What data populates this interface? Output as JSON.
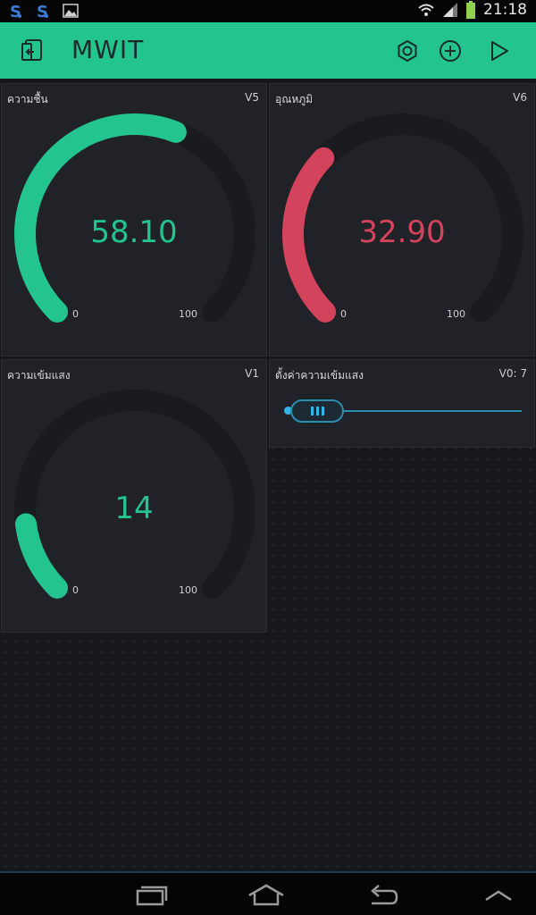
{
  "status_bar": {
    "time": "21:18",
    "left_icons": [
      "app-notification-icon",
      "app-notification-icon",
      "image-icon"
    ],
    "right_icons": [
      "wifi-icon",
      "signal-icon",
      "battery-icon"
    ]
  },
  "app_bar": {
    "title": "MWIT",
    "background": "#23c48e",
    "actions": [
      "settings-icon",
      "add-icon",
      "play-icon"
    ]
  },
  "widgets": {
    "humidity": {
      "label": "ความชื้น",
      "pin": "V5",
      "value": "58.10",
      "min": "0",
      "max": "100",
      "level": 58.1,
      "color": "#23c48e"
    },
    "temperature": {
      "label": "อุณหภูมิ",
      "pin": "V6",
      "value": "32.90",
      "min": "0",
      "max": "100",
      "level": 32.9,
      "color": "#d3435c"
    },
    "light": {
      "label": "ความเข้มแสง",
      "pin": "V1",
      "value": "14",
      "min": "0",
      "max": "100",
      "level": 14,
      "color": "#23c48e"
    },
    "light_setting": {
      "label": "ตั้งค่าความเข้มแสง",
      "pin": "V0: 7",
      "level": 7,
      "max": 100,
      "color": "#2a8fb0"
    }
  },
  "nav_bar": {
    "buttons": [
      "recent-apps-icon",
      "home-icon",
      "back-icon",
      "up-icon"
    ]
  }
}
